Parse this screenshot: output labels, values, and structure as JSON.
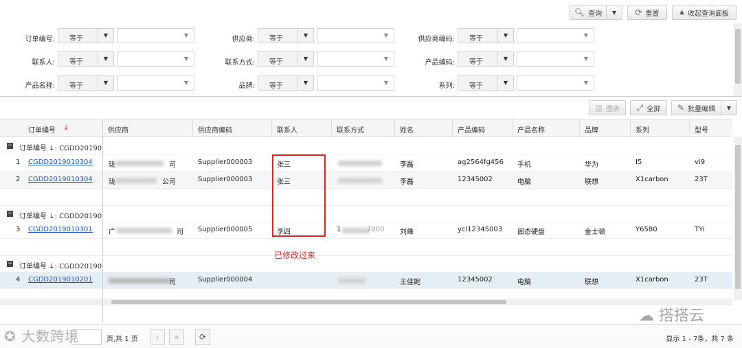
{
  "toolbar": {
    "query": "查询",
    "reset": "重置",
    "collapse": "收起查询面板"
  },
  "filters": {
    "labels": [
      "订单编号:",
      "供应商:",
      "供应商编码:",
      "联系人:",
      "联系方式:",
      "产品编码:",
      "产品名称:",
      "品牌:",
      "系列:"
    ],
    "operator": "等于"
  },
  "grid_toolbar": {
    "chart": "图表",
    "fullscreen": "全屏",
    "batch_edit": "批量编辑"
  },
  "columns": [
    "订单编号",
    "供应商",
    "供应商编码",
    "联系人",
    "联系方式",
    "姓名",
    "产品编码",
    "产品名称",
    "品牌",
    "系列",
    "型号"
  ],
  "sort_mark": "↓",
  "groups": [
    {
      "label": "订单编号",
      "value": "↓: CGDD20190"
    },
    {
      "label": "订单编号",
      "value": "↓: CGDD20190"
    },
    {
      "label": "订单编号",
      "value": "↓: CGDD20190"
    }
  ],
  "rows": [
    {
      "no": "1",
      "order": "CGDD2019010304",
      "supplier_a": "珑",
      "supplier_b": "司",
      "supplier_code": "Supplier000003",
      "contact": "张三",
      "phone_a": "",
      "phone_b": "",
      "name": "李磊",
      "product_code": "ag2564fg456",
      "product_name": "手机",
      "brand": "华为",
      "series": "I5",
      "model": "vi9"
    },
    {
      "no": "2",
      "order": "CGDD2019010304",
      "supplier_a": "珑",
      "supplier_b": "公司",
      "supplier_code": "Supplier000003",
      "contact": "张三",
      "phone_a": "",
      "phone_b": "",
      "name": "李磊",
      "product_code": "12345002",
      "product_name": "电脑",
      "brand": "联想",
      "series": "X1carbon",
      "model": "23T"
    },
    {
      "no": "3",
      "order": "CGDD2019010301",
      "supplier_a": "广",
      "supplier_b": "司",
      "supplier_code": "Supplier000005",
      "contact": "李四",
      "phone_a": "1",
      "phone_b": "7000",
      "name": "刘峰",
      "product_code": "ycl12345003",
      "product_name": "固态硬盘",
      "brand": "金士顿",
      "series": "Y6580",
      "model": "TYi"
    },
    {
      "no": "4",
      "order": "CGDD2019010201",
      "supplier_a": "",
      "supplier_b": "司",
      "supplier_code": "Supplier000004",
      "contact": "",
      "phone_a": "",
      "phone_b": "",
      "name": "王佳妮",
      "product_code": "12345002",
      "product_name": "电脑",
      "brand": "联想",
      "series": "X1carbon",
      "model": "23T"
    }
  ],
  "annotation": {
    "text": "已修改过来",
    "color": "#e02020"
  },
  "pager": {
    "page_of": "页,共 1 页",
    "info": "显示 1 - 7条，共 7 条"
  },
  "watermark": {
    "left": "大数跨境",
    "right": "搭搭云"
  }
}
